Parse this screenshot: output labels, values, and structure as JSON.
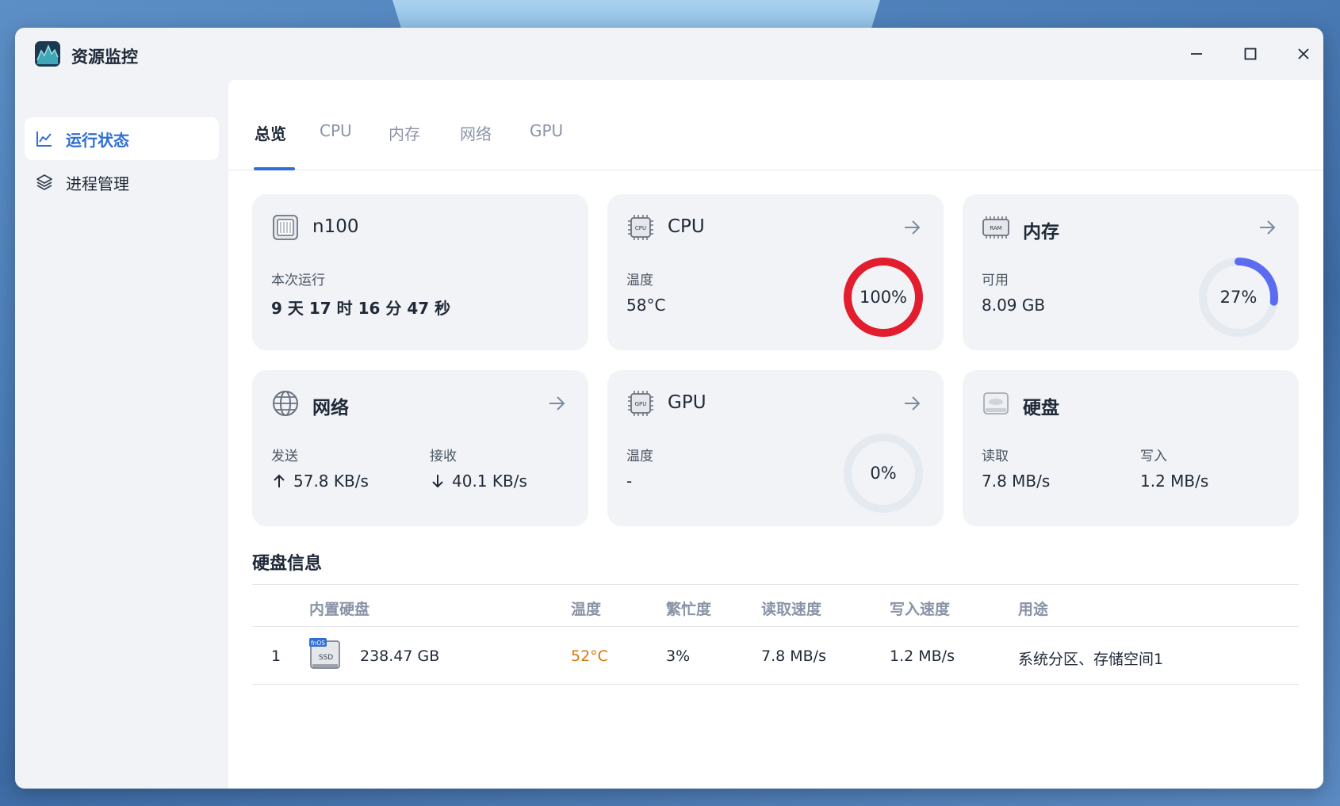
{
  "app": {
    "title": "资源监控"
  },
  "sidebar": {
    "items": [
      {
        "label": "运行状态",
        "icon": "chart-line-icon",
        "active": true
      },
      {
        "label": "进程管理",
        "icon": "layers-icon",
        "active": false
      }
    ]
  },
  "tabs": [
    {
      "label": "总览",
      "active": true
    },
    {
      "label": "CPU",
      "active": false
    },
    {
      "label": "内存",
      "active": false
    },
    {
      "label": "网络",
      "active": false
    },
    {
      "label": "GPU",
      "active": false
    }
  ],
  "cards": {
    "system": {
      "title": "n100",
      "uptime_label": "本次运行",
      "uptime_value": "9 天 17 时 16 分 47 秒"
    },
    "cpu": {
      "title": "CPU",
      "temp_label": "温度",
      "temp_value": "58°C",
      "usage_text": "100%",
      "usage": 1.0,
      "color": "#e11d2e"
    },
    "memory": {
      "title": "内存",
      "avail_label": "可用",
      "avail_value": "8.09 GB",
      "usage_text": "27%",
      "usage": 0.27,
      "color": "#5b6cf0"
    },
    "network": {
      "title": "网络",
      "send_label": "发送",
      "send_value": "57.8 KB/s",
      "recv_label": "接收",
      "recv_value": "40.1 KB/s"
    },
    "gpu": {
      "title": "GPU",
      "temp_label": "温度",
      "temp_value": "-",
      "usage_text": "0%",
      "usage": 0.0,
      "color": "#5b6cf0"
    },
    "disk": {
      "title": "硬盘",
      "read_label": "读取",
      "read_value": "7.8 MB/s",
      "write_label": "写入",
      "write_value": "1.2 MB/s"
    }
  },
  "disk_info": {
    "title": "硬盘信息",
    "columns": [
      "内置硬盘",
      "温度",
      "繁忙度",
      "读取速度",
      "写入速度",
      "用途"
    ],
    "rows": [
      {
        "index": "1",
        "badge": "fnOS",
        "badge2": "SSD",
        "capacity": "238.47 GB",
        "temp": "52°C",
        "busy": "3%",
        "read": "7.8 MB/s",
        "write": "1.2 MB/s",
        "usage": "系统分区、存储空间1"
      }
    ]
  },
  "colors": {
    "accent": "#2f6fd6",
    "gauge_track": "#e5e9f0",
    "warm_temp": "#d97706"
  }
}
